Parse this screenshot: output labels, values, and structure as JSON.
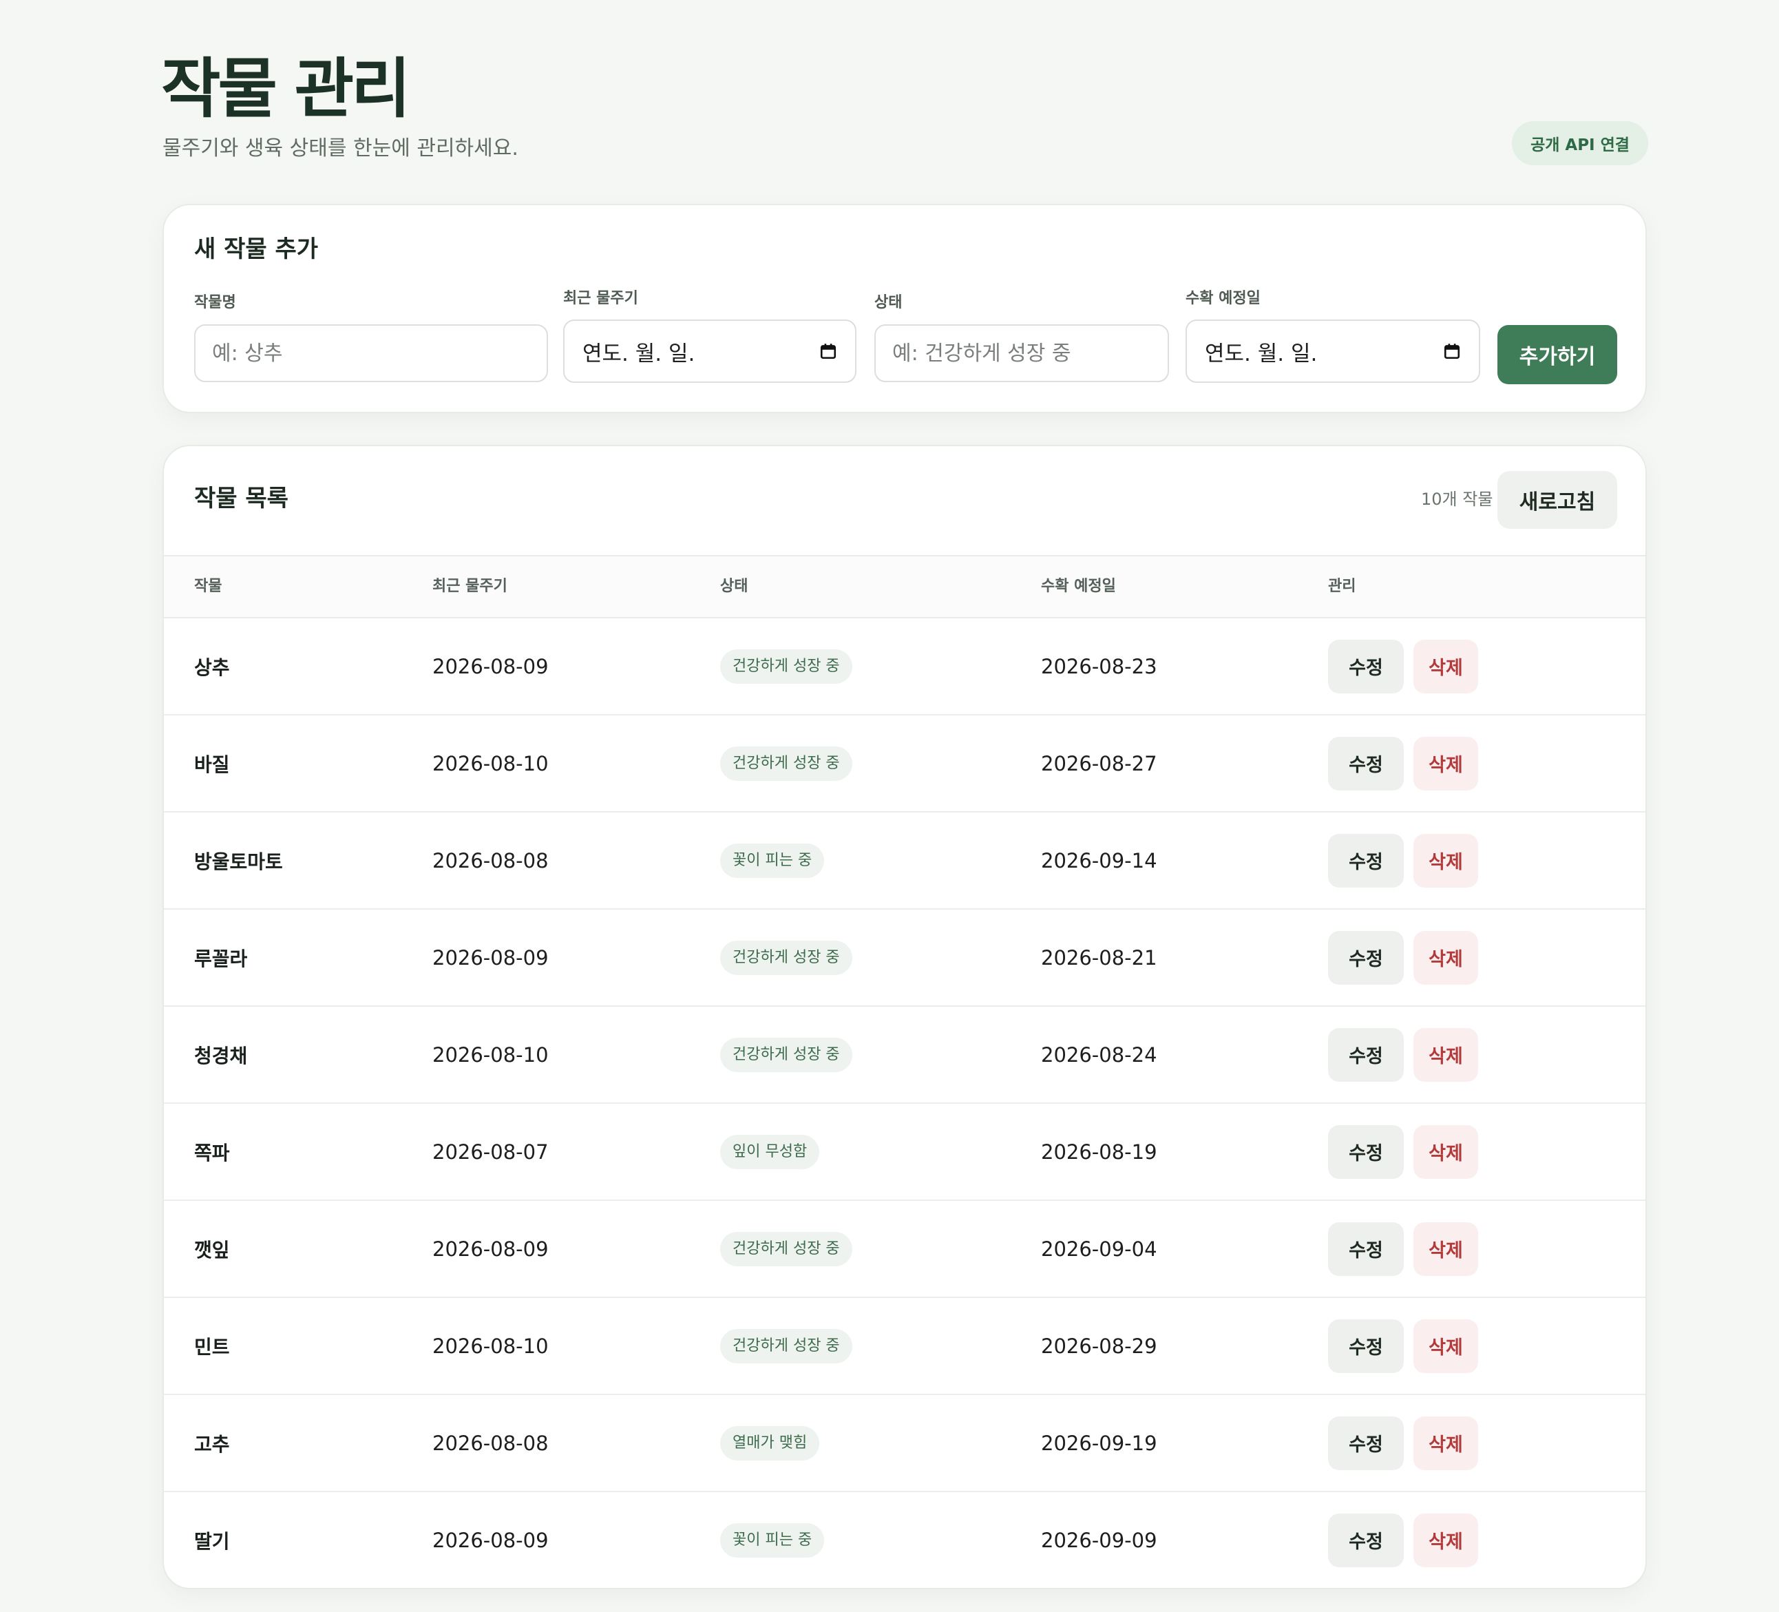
{
  "header": {
    "title": "작물 관리",
    "subtitle": "물주기와 생육 상태를 한눈에 관리하세요.",
    "api_badge": "공개 API 연결"
  },
  "add_form": {
    "title": "새 작물 추가",
    "name_label": "작물명",
    "name_placeholder": "예: 상추",
    "watered_label": "최근 물주기",
    "watered_value": "연도. 월. 일.",
    "status_label": "상태",
    "status_placeholder": "예: 건강하게 성장 중",
    "harvest_label": "수확 예정일",
    "harvest_value": "연도. 월. 일.",
    "submit_label": "추가하기",
    "calendar_icon": "calendar-icon"
  },
  "list": {
    "title": "작물 목록",
    "count": "10개 작물",
    "refresh_label": "새로고침",
    "columns": [
      "작물",
      "최근 물주기",
      "상태",
      "수확 예정일",
      "관리"
    ],
    "edit_label": "수정",
    "delete_label": "삭제",
    "rows": [
      {
        "name": "상추",
        "watered": "2026-08-09",
        "status": "건강하게 성장 중",
        "harvest": "2026-08-23"
      },
      {
        "name": "바질",
        "watered": "2026-08-10",
        "status": "건강하게 성장 중",
        "harvest": "2026-08-27"
      },
      {
        "name": "방울토마토",
        "watered": "2026-08-08",
        "status": "꽃이 피는 중",
        "harvest": "2026-09-14"
      },
      {
        "name": "루꼴라",
        "watered": "2026-08-09",
        "status": "건강하게 성장 중",
        "harvest": "2026-08-21"
      },
      {
        "name": "청경채",
        "watered": "2026-08-10",
        "status": "건강하게 성장 중",
        "harvest": "2026-08-24"
      },
      {
        "name": "쪽파",
        "watered": "2026-08-07",
        "status": "잎이 무성함",
        "harvest": "2026-08-19"
      },
      {
        "name": "깻잎",
        "watered": "2026-08-09",
        "status": "건강하게 성장 중",
        "harvest": "2026-09-04"
      },
      {
        "name": "민트",
        "watered": "2026-08-10",
        "status": "건강하게 성장 중",
        "harvest": "2026-08-29"
      },
      {
        "name": "고추",
        "watered": "2026-08-08",
        "status": "열매가 맺힘",
        "harvest": "2026-09-19"
      },
      {
        "name": "딸기",
        "watered": "2026-08-09",
        "status": "꽃이 피는 중",
        "harvest": "2026-09-09"
      }
    ]
  },
  "colors": {
    "primary": "#3e7d58",
    "background": "#f5f7f4",
    "danger": "#b23a3a",
    "badge_background": "#e4efe6"
  }
}
